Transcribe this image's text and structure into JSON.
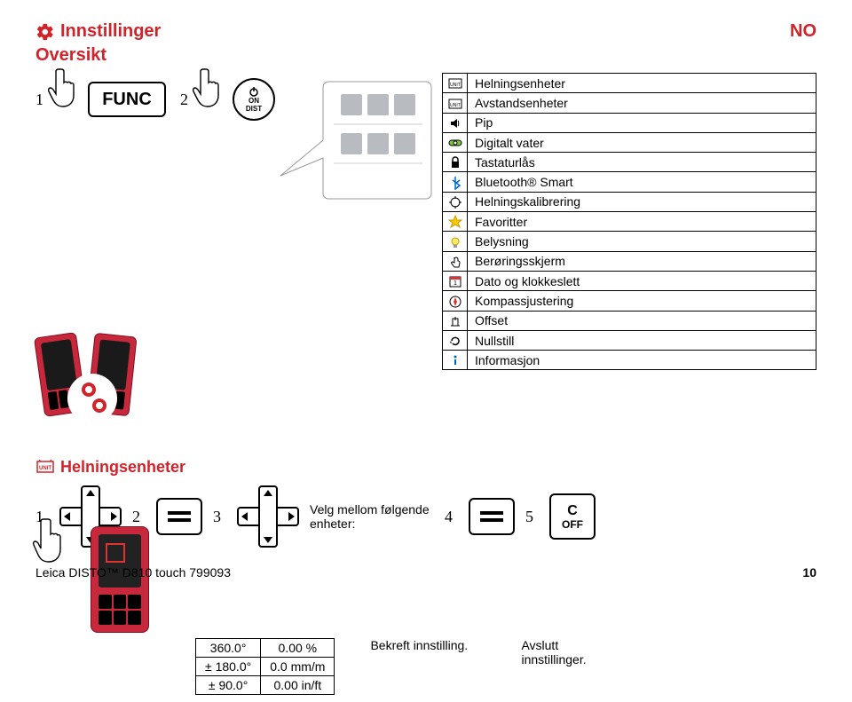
{
  "header": {
    "title": "Innstillinger",
    "subtitle": "Oversikt",
    "lang": "NO"
  },
  "steps_top": {
    "s1": "1",
    "s2": "2"
  },
  "func_label": "FUNC",
  "on_btn": {
    "top": "ON",
    "bot": "DIST"
  },
  "settings": [
    {
      "label": "Helningsenheter",
      "icon": "angle-unit-icon"
    },
    {
      "label": "Avstandsenheter",
      "icon": "dist-unit-icon"
    },
    {
      "label": "Pip",
      "icon": "sound-icon"
    },
    {
      "label": "Digitalt vater",
      "icon": "level-icon"
    },
    {
      "label": "Tastaturlås",
      "icon": "lock-icon"
    },
    {
      "label": "Bluetooth® Smart",
      "icon": "bluetooth-icon"
    },
    {
      "label": "Helningskalibrering",
      "icon": "calibrate-icon"
    },
    {
      "label": "Favoritter",
      "icon": "star-icon"
    },
    {
      "label": "Belysning",
      "icon": "bulb-icon"
    },
    {
      "label": "Berøringsskjerm",
      "icon": "touch-icon"
    },
    {
      "label": "Dato og klokkeslett",
      "icon": "calendar-icon"
    },
    {
      "label": "Kompassjustering",
      "icon": "compass-icon"
    },
    {
      "label": "Offset",
      "icon": "offset-icon"
    },
    {
      "label": "Nullstill",
      "icon": "reset-icon"
    },
    {
      "label": "Informasjon",
      "icon": "info-icon"
    }
  ],
  "section2_title": "Helningsenheter",
  "row2": {
    "s1": "1",
    "s2": "2",
    "s3": "3",
    "s4": "4",
    "s5": "5",
    "step3_text": "Velg mellom følgende enheter:",
    "confirm": "Bekreft innstilling.",
    "end": "Avslutt innstillinger."
  },
  "c_off": {
    "c": "C",
    "off": "OFF"
  },
  "units": {
    "col1": [
      "360.0°",
      "± 180.0°",
      "± 90.0°"
    ],
    "col2": [
      "0.00 %",
      "0.0 mm/m",
      "0.00 in/ft"
    ]
  },
  "footer": {
    "product": "Leica DISTO™ D810 touch 799093",
    "page": "10"
  }
}
